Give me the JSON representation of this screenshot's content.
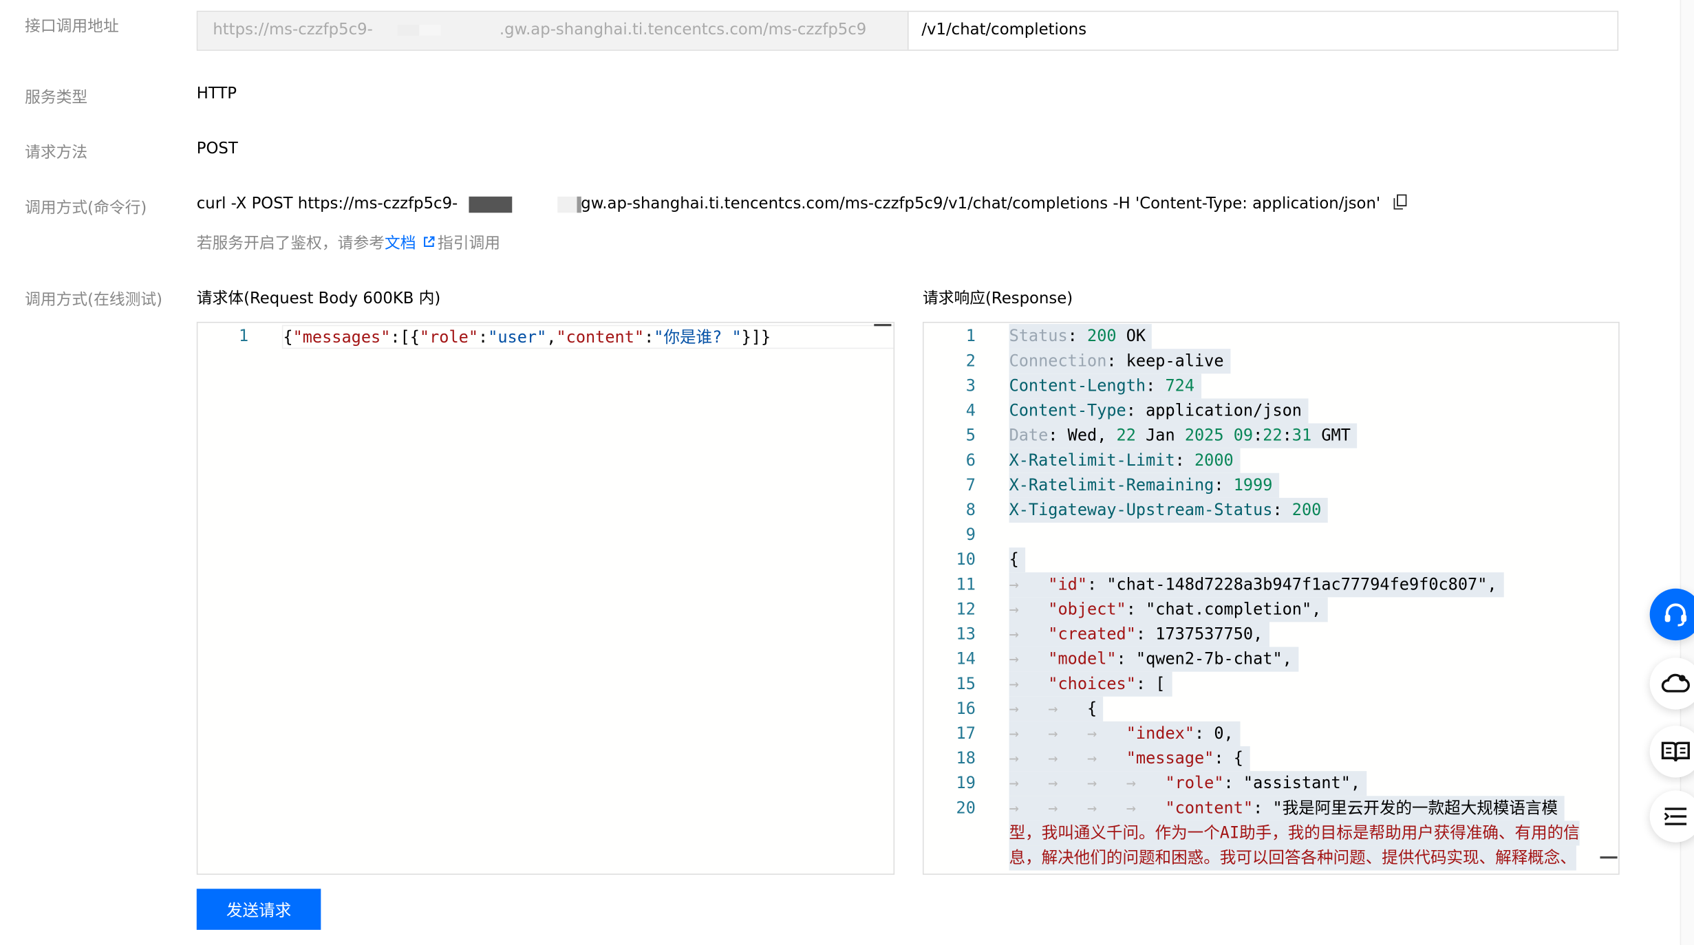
{
  "fields": {
    "endpoint_label": "接口调用地址",
    "endpoint_base_prefix": "https://ms-czzfp5c9-",
    "endpoint_base_suffix": ".gw.ap-shanghai.ti.tencentcs.com/ms-czzfp5c9",
    "endpoint_path": "/v1/chat/completions",
    "service_type_label": "服务类型",
    "service_type_value": "HTTP",
    "method_label": "请求方法",
    "method_value": "POST",
    "cmd_label": "调用方式(命令行)",
    "cmd_prefix": "curl -X POST https://ms-czzfp5c9-",
    "cmd_suffix": "gw.ap-shanghai.ti.tencentcs.com/ms-czzfp5c9/v1/chat/completions -H 'Content-Type: application/json'",
    "hint_before": "若服务开启了鉴权，请参考",
    "hint_link": "文档",
    "hint_after": "指引调用",
    "online_label": "调用方式(在线测试)"
  },
  "request": {
    "title": "请求体(Request Body 600KB 内)",
    "line_number": "1",
    "body": "{\"messages\":[{\"role\":\"user\",\"content\":\"你是谁? \"}]}"
  },
  "response": {
    "title": "请求响应(Response)",
    "line_numbers": [
      "1",
      "2",
      "3",
      "4",
      "5",
      "6",
      "7",
      "8",
      "9",
      "10",
      "11",
      "12",
      "13",
      "14",
      "15",
      "16",
      "17",
      "18",
      "19",
      "20"
    ],
    "lines": [
      "Status: 200 OK",
      "Connection: keep-alive",
      "Content-Length: 724",
      "Content-Type: application/json",
      "Date: Wed, 22 Jan 2025 09:22:31 GMT",
      "X-Ratelimit-Limit: 2000",
      "X-Ratelimit-Remaining: 1999",
      "X-Tigateway-Upstream-Status: 200",
      "",
      "{",
      "\"id\": \"chat-148d7228a3b947f1ac77794fe9f0c807\",",
      "\"object\": \"chat.completion\",",
      "\"created\": 1737537750,",
      "\"model\": \"qwen2-7b-chat\",",
      "\"choices\": [",
      "{",
      "\"index\": 0,",
      "\"message\": {",
      "\"role\": \"assistant\",",
      "\"content\": \"我是阿里云开发的一款超大规模语言模"
    ],
    "wrap_lines": [
      "型，我叫通义千问。作为一个AI助手，我的目标是帮助用户获得准确、有用的信",
      "息，解决他们的问题和困惑。我可以回答各种问题、提供代码实现、解释概念、"
    ]
  },
  "send_button": "发送请求",
  "side_icons": [
    "headset-icon",
    "cloud-user-icon",
    "book-icon",
    "list-icon"
  ],
  "colors": {
    "accent": "#006eff"
  }
}
